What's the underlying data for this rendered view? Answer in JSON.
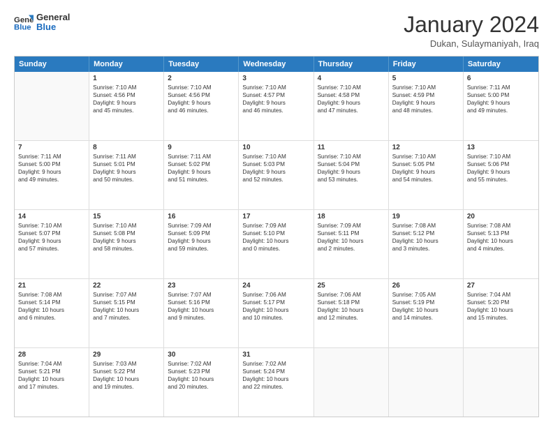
{
  "logo": {
    "general": "General",
    "blue": "Blue"
  },
  "header": {
    "title": "January 2024",
    "subtitle": "Dukan, Sulaymaniyah, Iraq"
  },
  "weekdays": [
    "Sunday",
    "Monday",
    "Tuesday",
    "Wednesday",
    "Thursday",
    "Friday",
    "Saturday"
  ],
  "weeks": [
    [
      {
        "day": "",
        "lines": []
      },
      {
        "day": "1",
        "lines": [
          "Sunrise: 7:10 AM",
          "Sunset: 4:56 PM",
          "Daylight: 9 hours",
          "and 45 minutes."
        ]
      },
      {
        "day": "2",
        "lines": [
          "Sunrise: 7:10 AM",
          "Sunset: 4:56 PM",
          "Daylight: 9 hours",
          "and 46 minutes."
        ]
      },
      {
        "day": "3",
        "lines": [
          "Sunrise: 7:10 AM",
          "Sunset: 4:57 PM",
          "Daylight: 9 hours",
          "and 46 minutes."
        ]
      },
      {
        "day": "4",
        "lines": [
          "Sunrise: 7:10 AM",
          "Sunset: 4:58 PM",
          "Daylight: 9 hours",
          "and 47 minutes."
        ]
      },
      {
        "day": "5",
        "lines": [
          "Sunrise: 7:10 AM",
          "Sunset: 4:59 PM",
          "Daylight: 9 hours",
          "and 48 minutes."
        ]
      },
      {
        "day": "6",
        "lines": [
          "Sunrise: 7:11 AM",
          "Sunset: 5:00 PM",
          "Daylight: 9 hours",
          "and 49 minutes."
        ]
      }
    ],
    [
      {
        "day": "7",
        "lines": [
          "Sunrise: 7:11 AM",
          "Sunset: 5:00 PM",
          "Daylight: 9 hours",
          "and 49 minutes."
        ]
      },
      {
        "day": "8",
        "lines": [
          "Sunrise: 7:11 AM",
          "Sunset: 5:01 PM",
          "Daylight: 9 hours",
          "and 50 minutes."
        ]
      },
      {
        "day": "9",
        "lines": [
          "Sunrise: 7:11 AM",
          "Sunset: 5:02 PM",
          "Daylight: 9 hours",
          "and 51 minutes."
        ]
      },
      {
        "day": "10",
        "lines": [
          "Sunrise: 7:10 AM",
          "Sunset: 5:03 PM",
          "Daylight: 9 hours",
          "and 52 minutes."
        ]
      },
      {
        "day": "11",
        "lines": [
          "Sunrise: 7:10 AM",
          "Sunset: 5:04 PM",
          "Daylight: 9 hours",
          "and 53 minutes."
        ]
      },
      {
        "day": "12",
        "lines": [
          "Sunrise: 7:10 AM",
          "Sunset: 5:05 PM",
          "Daylight: 9 hours",
          "and 54 minutes."
        ]
      },
      {
        "day": "13",
        "lines": [
          "Sunrise: 7:10 AM",
          "Sunset: 5:06 PM",
          "Daylight: 9 hours",
          "and 55 minutes."
        ]
      }
    ],
    [
      {
        "day": "14",
        "lines": [
          "Sunrise: 7:10 AM",
          "Sunset: 5:07 PM",
          "Daylight: 9 hours",
          "and 57 minutes."
        ]
      },
      {
        "day": "15",
        "lines": [
          "Sunrise: 7:10 AM",
          "Sunset: 5:08 PM",
          "Daylight: 9 hours",
          "and 58 minutes."
        ]
      },
      {
        "day": "16",
        "lines": [
          "Sunrise: 7:09 AM",
          "Sunset: 5:09 PM",
          "Daylight: 9 hours",
          "and 59 minutes."
        ]
      },
      {
        "day": "17",
        "lines": [
          "Sunrise: 7:09 AM",
          "Sunset: 5:10 PM",
          "Daylight: 10 hours",
          "and 0 minutes."
        ]
      },
      {
        "day": "18",
        "lines": [
          "Sunrise: 7:09 AM",
          "Sunset: 5:11 PM",
          "Daylight: 10 hours",
          "and 2 minutes."
        ]
      },
      {
        "day": "19",
        "lines": [
          "Sunrise: 7:08 AM",
          "Sunset: 5:12 PM",
          "Daylight: 10 hours",
          "and 3 minutes."
        ]
      },
      {
        "day": "20",
        "lines": [
          "Sunrise: 7:08 AM",
          "Sunset: 5:13 PM",
          "Daylight: 10 hours",
          "and 4 minutes."
        ]
      }
    ],
    [
      {
        "day": "21",
        "lines": [
          "Sunrise: 7:08 AM",
          "Sunset: 5:14 PM",
          "Daylight: 10 hours",
          "and 6 minutes."
        ]
      },
      {
        "day": "22",
        "lines": [
          "Sunrise: 7:07 AM",
          "Sunset: 5:15 PM",
          "Daylight: 10 hours",
          "and 7 minutes."
        ]
      },
      {
        "day": "23",
        "lines": [
          "Sunrise: 7:07 AM",
          "Sunset: 5:16 PM",
          "Daylight: 10 hours",
          "and 9 minutes."
        ]
      },
      {
        "day": "24",
        "lines": [
          "Sunrise: 7:06 AM",
          "Sunset: 5:17 PM",
          "Daylight: 10 hours",
          "and 10 minutes."
        ]
      },
      {
        "day": "25",
        "lines": [
          "Sunrise: 7:06 AM",
          "Sunset: 5:18 PM",
          "Daylight: 10 hours",
          "and 12 minutes."
        ]
      },
      {
        "day": "26",
        "lines": [
          "Sunrise: 7:05 AM",
          "Sunset: 5:19 PM",
          "Daylight: 10 hours",
          "and 14 minutes."
        ]
      },
      {
        "day": "27",
        "lines": [
          "Sunrise: 7:04 AM",
          "Sunset: 5:20 PM",
          "Daylight: 10 hours",
          "and 15 minutes."
        ]
      }
    ],
    [
      {
        "day": "28",
        "lines": [
          "Sunrise: 7:04 AM",
          "Sunset: 5:21 PM",
          "Daylight: 10 hours",
          "and 17 minutes."
        ]
      },
      {
        "day": "29",
        "lines": [
          "Sunrise: 7:03 AM",
          "Sunset: 5:22 PM",
          "Daylight: 10 hours",
          "and 19 minutes."
        ]
      },
      {
        "day": "30",
        "lines": [
          "Sunrise: 7:02 AM",
          "Sunset: 5:23 PM",
          "Daylight: 10 hours",
          "and 20 minutes."
        ]
      },
      {
        "day": "31",
        "lines": [
          "Sunrise: 7:02 AM",
          "Sunset: 5:24 PM",
          "Daylight: 10 hours",
          "and 22 minutes."
        ]
      },
      {
        "day": "",
        "lines": []
      },
      {
        "day": "",
        "lines": []
      },
      {
        "day": "",
        "lines": []
      }
    ]
  ]
}
